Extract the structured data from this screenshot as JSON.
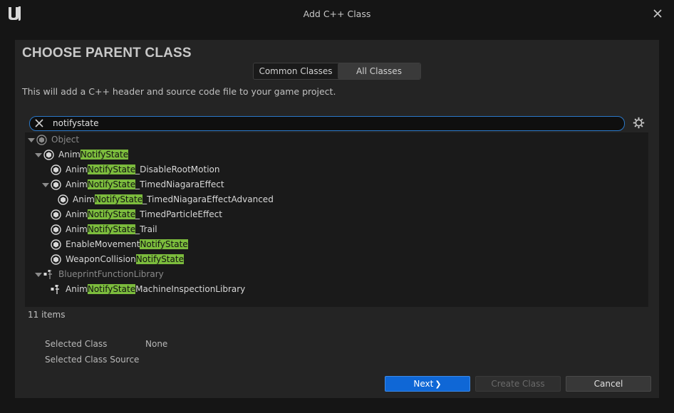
{
  "window": {
    "title": "Add C++ Class",
    "logo": "unreal-logo",
    "close_icon": "close-icon"
  },
  "heading": "CHOOSE PARENT CLASS",
  "mode_tabs": [
    {
      "label": "Common Classes",
      "selected": false
    },
    {
      "label": "All Classes",
      "selected": true
    }
  ],
  "description": "This will add a C++ header and source code file to your game project.",
  "search": {
    "value": "notifystate",
    "placeholder": ""
  },
  "tree": [
    {
      "parts": [
        "Object"
      ],
      "dim": true,
      "expanded": true,
      "icon": "object-class-icon"
    },
    {
      "parts": [
        "Anim",
        "NotifyState",
        ""
      ],
      "dim": false,
      "expanded": true,
      "icon": "object-class-icon"
    },
    {
      "parts": [
        "Anim",
        "NotifyState",
        "_DisableRootMotion"
      ],
      "dim": false,
      "icon": "object-class-icon"
    },
    {
      "parts": [
        "Anim",
        "NotifyState",
        "_TimedNiagaraEffect"
      ],
      "dim": false,
      "expanded": true,
      "icon": "object-class-icon"
    },
    {
      "parts": [
        "Anim",
        "NotifyState",
        "_TimedNiagaraEffectAdvanced"
      ],
      "dim": false,
      "icon": "object-class-icon"
    },
    {
      "parts": [
        "Anim",
        "NotifyState",
        "_TimedParticleEffect"
      ],
      "dim": false,
      "icon": "object-class-icon"
    },
    {
      "parts": [
        "Anim",
        "NotifyState",
        "_Trail"
      ],
      "dim": false,
      "icon": "object-class-icon"
    },
    {
      "parts": [
        "EnableMovement",
        "NotifyState",
        ""
      ],
      "dim": false,
      "icon": "object-class-icon"
    },
    {
      "parts": [
        "WeaponCollision",
        "NotifyState",
        ""
      ],
      "dim": false,
      "icon": "object-class-icon"
    },
    {
      "parts": [
        "BlueprintFunctionLibrary"
      ],
      "dim": true,
      "expanded": true,
      "icon": "function-library-icon"
    },
    {
      "parts": [
        "Anim",
        "NotifyState",
        "MachineInspectionLibrary"
      ],
      "dim": false,
      "icon": "function-library-icon"
    }
  ],
  "item_count": "11 items",
  "selected_class": {
    "label": "Selected Class",
    "value": "None"
  },
  "selected_class_source": {
    "label": "Selected Class Source",
    "value": ""
  },
  "buttons": {
    "next": "Next",
    "create": "Create Class",
    "cancel": "Cancel"
  },
  "colors": {
    "highlight": "#7cbc3d",
    "accent_button": "#0f67d6",
    "search_border": "#2a78c8"
  }
}
